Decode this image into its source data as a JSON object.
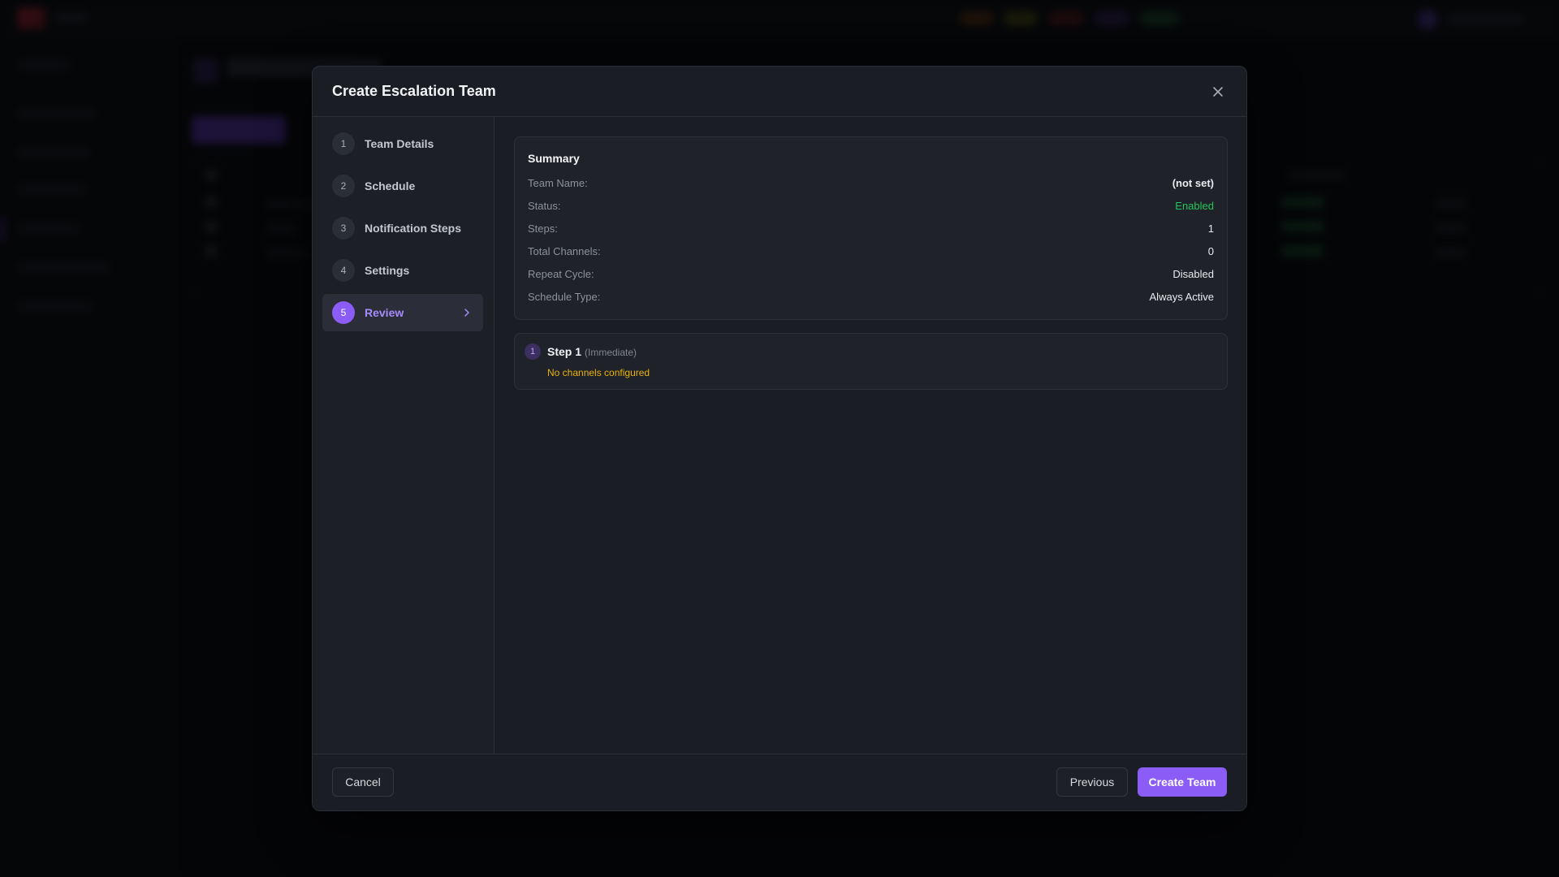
{
  "modal": {
    "title": "Create Escalation Team",
    "close_icon": "close-icon"
  },
  "wizard": {
    "steps": [
      {
        "number": "1",
        "label": "Team Details"
      },
      {
        "number": "2",
        "label": "Schedule"
      },
      {
        "number": "3",
        "label": "Notification Steps"
      },
      {
        "number": "4",
        "label": "Settings"
      },
      {
        "number": "5",
        "label": "Review"
      }
    ],
    "active_step": 5
  },
  "summary": {
    "title": "Summary",
    "rows": [
      {
        "key": "Team Name:",
        "value": "(not set)"
      },
      {
        "key": "Status:",
        "value": "Enabled"
      },
      {
        "key": "Steps:",
        "value": "1"
      },
      {
        "key": "Total Channels:",
        "value": "0"
      },
      {
        "key": "Repeat Cycle:",
        "value": "Disabled"
      },
      {
        "key": "Schedule Type:",
        "value": "Always Active"
      }
    ],
    "status_color": "#22c55e"
  },
  "steps_review": [
    {
      "number": "1",
      "title": "Step 1",
      "subtitle": "(Immediate)",
      "warning": "No channels configured",
      "warning_color": "#eab308"
    }
  ],
  "footer": {
    "cancel_label": "Cancel",
    "previous_label": "Previous",
    "create_label": "Create Team"
  },
  "colors": {
    "accent": "#8b5cf6",
    "modal_bg": "#1a1d23"
  }
}
